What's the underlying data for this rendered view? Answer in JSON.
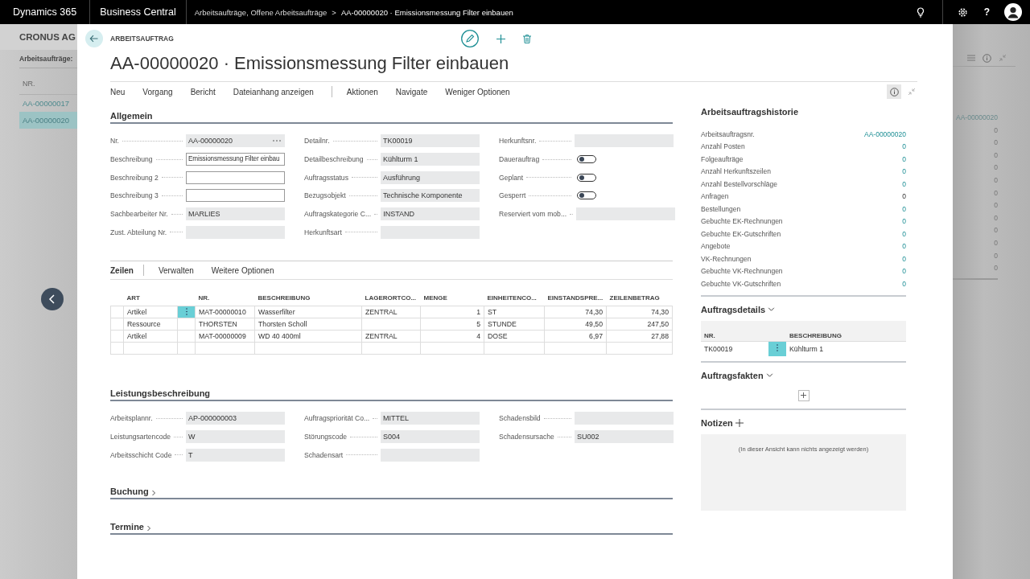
{
  "topbar": {
    "product": "Dynamics 365",
    "app": "Business Central",
    "breadcrumb": "Arbeitsaufträge, Offene Arbeitsaufträge",
    "separator": ">",
    "current": "AA-00000020 · Emissionsmessung Filter einbauen",
    "help": "?"
  },
  "background": {
    "company": "CRONUS AG",
    "list_title": "Arbeitsaufträge:",
    "column": "NR.",
    "rows": [
      {
        "no": "AA-00000017",
        "selected": false
      },
      {
        "no": "AA-00000020",
        "selected": true
      }
    ],
    "right_values": [
      "AA-00000020",
      "0",
      "0",
      "0",
      "0",
      "0",
      "0",
      "0",
      "0",
      "0",
      "0",
      "0",
      "0"
    ]
  },
  "card": {
    "caption": "ARBEITSAUFTRAG",
    "title": "AA-00000020 · Emissionsmessung Filter einbauen",
    "actions": [
      "Neu",
      "Vorgang",
      "Bericht",
      "Dateianhang anzeigen"
    ],
    "actions_more": [
      "Aktionen",
      "Navigate",
      "Weniger Optionen"
    ]
  },
  "general": {
    "title": "Allgemein",
    "columns": [
      {
        "fields": [
          {
            "label": "Nr.",
            "value": "AA-00000020",
            "kind": "lookup"
          },
          {
            "label": "Beschreibung",
            "value": "Emissionsmessung Filter einbau",
            "kind": "input"
          },
          {
            "label": "Beschreibung 2",
            "kind": "input"
          },
          {
            "label": "Beschreibung 3",
            "kind": "input"
          },
          {
            "label": "Sachbearbeiter Nr.",
            "value": "MARLIES",
            "kind": "text"
          },
          {
            "label": "Zust. Abteilung Nr.",
            "kind": "text"
          }
        ]
      },
      {
        "fields": [
          {
            "label": "Detailnr.",
            "value": "TK00019",
            "kind": "text"
          },
          {
            "label": "Detailbeschreibung",
            "value": "Kühlturm 1",
            "kind": "text"
          },
          {
            "label": "Auftragsstatus",
            "value": "Ausführung",
            "kind": "text"
          },
          {
            "label": "Bezugsobjekt",
            "value": "Technische Komponente",
            "kind": "text"
          },
          {
            "label": "Auftragskategorie C...",
            "value": "INSTAND",
            "kind": "text"
          },
          {
            "label": "Herkunftsart",
            "kind": "text"
          }
        ]
      },
      {
        "fields": [
          {
            "label": "Herkunftsnr.",
            "kind": "text"
          },
          {
            "label": "Dauerauftrag",
            "kind": "toggle",
            "on": false
          },
          {
            "label": "Geplant",
            "kind": "toggle",
            "on": false
          },
          {
            "label": "Gesperrt",
            "kind": "toggle",
            "on": false
          },
          {
            "label": "Reserviert vom mob...",
            "kind": "text"
          }
        ]
      }
    ]
  },
  "lines": {
    "title": "Zeilen",
    "actions": [
      "Verwalten",
      "Weitere Optionen"
    ],
    "columns": [
      "ART",
      "NR.",
      "BESCHREIBUNG",
      "LAGERORTCO...",
      "MENGE",
      "EINHEITENCO...",
      "EINSTANDSPRE...",
      "ZEILENBETRAG"
    ],
    "rows": [
      {
        "selected": true,
        "cells": [
          "Artikel",
          "MAT-00000010",
          "Wasserfilter",
          "ZENTRAL",
          "1",
          "ST",
          "74,30",
          "74,30"
        ]
      },
      {
        "selected": false,
        "cells": [
          "Ressource",
          "THORSTEN",
          "Thorsten Scholl",
          "",
          "5",
          "STUNDE",
          "49,50",
          "247,50"
        ]
      },
      {
        "selected": false,
        "cells": [
          "Artikel",
          "MAT-00000009",
          "WD 40 400ml",
          "ZENTRAL",
          "4",
          "DOSE",
          "6,97",
          "27,88"
        ]
      }
    ]
  },
  "service": {
    "title": "Leistungsbeschreibung",
    "columns": [
      {
        "fields": [
          {
            "label": "Arbeitsplannr.",
            "value": "AP-000000003",
            "kind": "text"
          },
          {
            "label": "Leistungsartencode",
            "value": "W",
            "kind": "text"
          },
          {
            "label": "Arbeitsschicht Code",
            "value": "T",
            "kind": "text"
          }
        ]
      },
      {
        "fields": [
          {
            "label": "Auftragspriorität Co...",
            "value": "MITTEL",
            "kind": "text"
          },
          {
            "label": "Störungscode",
            "value": "S004",
            "kind": "text"
          },
          {
            "label": "Schadensart",
            "kind": "text"
          }
        ]
      },
      {
        "fields": [
          {
            "label": "Schadensbild",
            "kind": "text"
          },
          {
            "label": "Schadensursache",
            "value": "SU002",
            "kind": "text"
          }
        ]
      }
    ]
  },
  "collapsed_sections": [
    {
      "title": "Buchung",
      "expanded": false
    },
    {
      "title": "Termine",
      "expanded": false
    }
  ],
  "history": {
    "title": "Arbeitsauftragshistorie",
    "rows": [
      {
        "label": "Arbeitsauftragsnr.",
        "value": "AA-00000020",
        "link": true
      },
      {
        "label": "Anzahl Posten",
        "value": "0",
        "link": true
      },
      {
        "label": "Folgeaufträge",
        "value": "0",
        "link": true
      },
      {
        "label": "Anzahl Herkunftszeilen",
        "value": "0",
        "link": true
      },
      {
        "label": "Anzahl Bestellvorschläge",
        "value": "0",
        "link": true
      },
      {
        "label": "Anfragen",
        "value": "0",
        "link": false
      },
      {
        "label": "Bestellungen",
        "value": "0",
        "link": true
      },
      {
        "label": "Gebuchte EK-Rechnungen",
        "value": "0",
        "link": true
      },
      {
        "label": "Gebuchte EK-Gutschriften",
        "value": "0",
        "link": true
      },
      {
        "label": "Angebote",
        "value": "0",
        "link": true
      },
      {
        "label": "VK-Rechnungen",
        "value": "0",
        "link": true
      },
      {
        "label": "Gebuchte VK-Rechnungen",
        "value": "0",
        "link": true
      },
      {
        "label": "Gebuchte VK-Gutschriften",
        "value": "0",
        "link": true
      }
    ]
  },
  "details": {
    "title": "Auftragsdetails",
    "expanded": true,
    "columns": [
      "NR.",
      "BESCHREIBUNG"
    ],
    "rows": [
      {
        "selected": true,
        "cells": [
          "TK00019",
          "Kühlturm 1"
        ]
      }
    ]
  },
  "facts": {
    "title": "Auftragsfakten",
    "expanded": true
  },
  "notes": {
    "title": "Notizen",
    "empty_text": "(In dieser Ansicht kann nichts angezeigt werden)"
  }
}
